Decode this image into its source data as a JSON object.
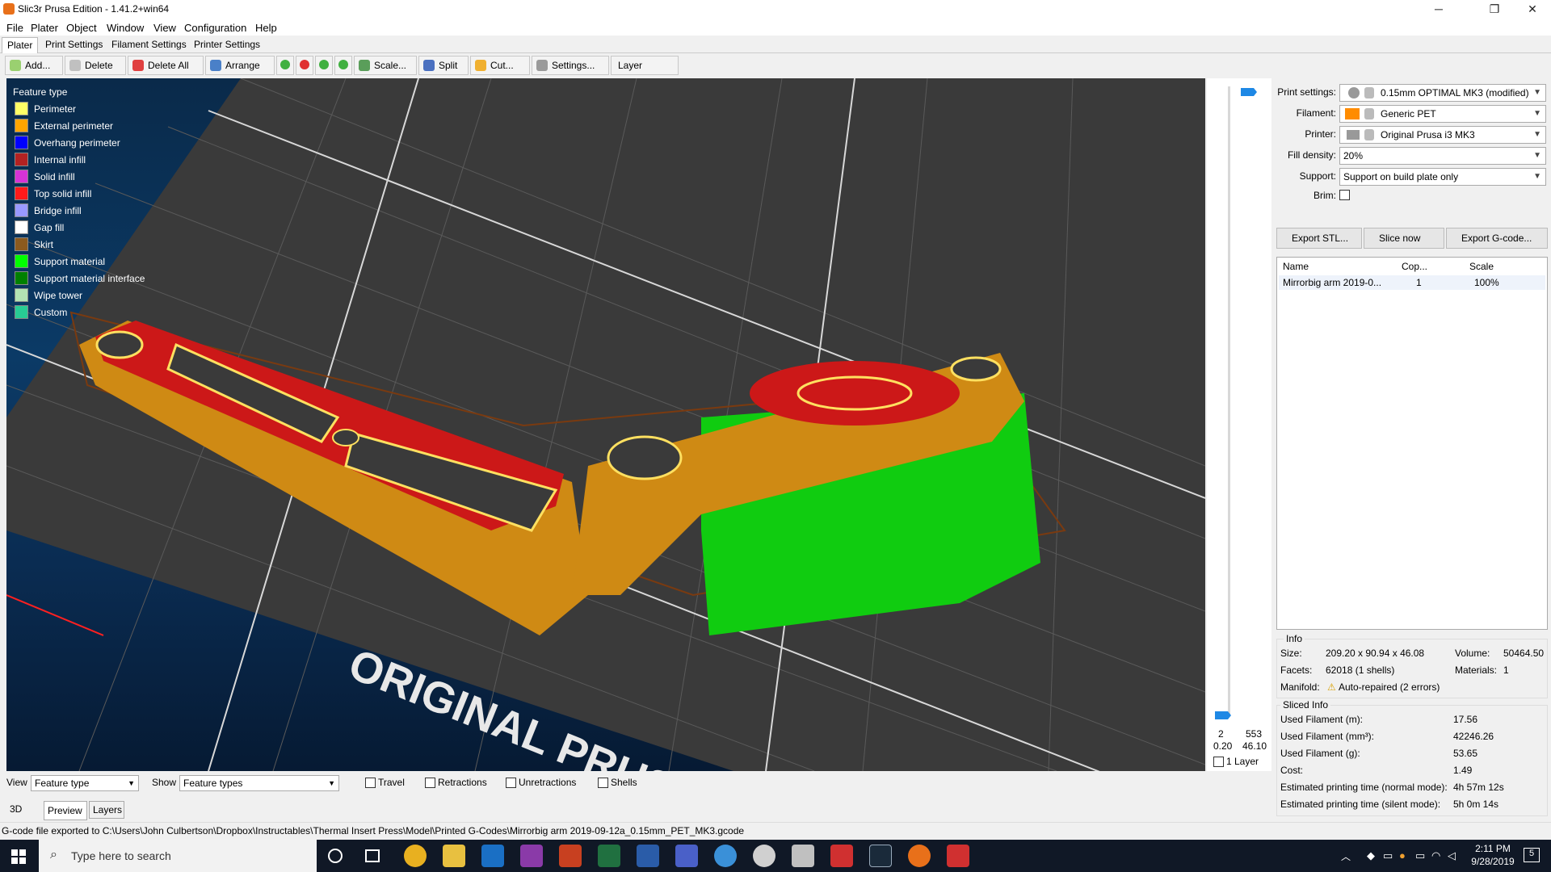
{
  "window": {
    "title": "Slic3r Prusa Edition - 1.41.2+win64",
    "minimize": "─",
    "maximize": "❐",
    "close": "✕"
  },
  "menu": [
    "File",
    "Plater",
    "Object",
    "Window",
    "View",
    "Configuration",
    "Help"
  ],
  "tabs": [
    "Plater",
    "Print Settings",
    "Filament Settings",
    "Printer Settings"
  ],
  "toolbar": {
    "add": "Add...",
    "delete": "Delete",
    "delete_all": "Delete All",
    "arrange": "Arrange",
    "scale": "Scale...",
    "split": "Split",
    "cut": "Cut...",
    "settings": "Settings...",
    "layer_editing": "Layer editing"
  },
  "legend": {
    "title": "Feature type",
    "items": [
      {
        "label": "Perimeter",
        "color": "#ffff66"
      },
      {
        "label": "External perimeter",
        "color": "#ffa500"
      },
      {
        "label": "Overhang perimeter",
        "color": "#0000ff"
      },
      {
        "label": "Internal infill",
        "color": "#b22222"
      },
      {
        "label": "Solid infill",
        "color": "#d633d6"
      },
      {
        "label": "Top solid infill",
        "color": "#ff1a1a"
      },
      {
        "label": "Bridge infill",
        "color": "#9999ff"
      },
      {
        "label": "Gap fill",
        "color": "#ffffff"
      },
      {
        "label": "Skirt",
        "color": "#8b5a1e"
      },
      {
        "label": "Support material",
        "color": "#00ff00"
      },
      {
        "label": "Support material interface",
        "color": "#008000"
      },
      {
        "label": "Wipe tower",
        "color": "#b3e3b3"
      },
      {
        "label": "Custom",
        "color": "#28cc94"
      }
    ]
  },
  "bed_label": "ORIGINAL PRUS",
  "layer_slider": {
    "top_layer": "2",
    "top_count": "553",
    "bottom_height": "0.20",
    "top_height": "46.10",
    "one_layer": "1 Layer"
  },
  "print_settings": {
    "print_label": "Print settings:",
    "print_value": "0.15mm OPTIMAL MK3 (modified)",
    "filament_label": "Filament:",
    "filament_value": "Generic PET",
    "filament_color": "#ff8c00",
    "printer_label": "Printer:",
    "printer_value": "Original Prusa i3 MK3",
    "fill_label": "Fill density:",
    "fill_value": "20%",
    "support_label": "Support:",
    "support_value": "Support on build plate only",
    "brim_label": "Brim:"
  },
  "actions": {
    "export_stl": "Export STL...",
    "slice_now": "Slice now",
    "export_gcode": "Export G-code..."
  },
  "object_list": {
    "headers": [
      "Name",
      "Cop...",
      "Scale"
    ],
    "rows": [
      {
        "name": "Mirrorbig arm 2019-0...",
        "copies": "1",
        "scale": "100%"
      }
    ]
  },
  "info": {
    "title": "Info",
    "size_label": "Size:",
    "size_value": "209.20 x 90.94 x 46.08",
    "volume_label": "Volume:",
    "volume_value": "50464.50",
    "facets_label": "Facets:",
    "facets_value": "62018 (1 shells)",
    "materials_label": "Materials:",
    "materials_value": "1",
    "manifold_label": "Manifold:",
    "manifold_value": "Auto-repaired (2 errors)"
  },
  "sliced": {
    "title": "Sliced Info",
    "rows": [
      {
        "label": "Used Filament (m):",
        "value": "17.56"
      },
      {
        "label": "Used Filament (mm³):",
        "value": "42246.26"
      },
      {
        "label": "Used Filament (g):",
        "value": "53.65"
      },
      {
        "label": "Cost:",
        "value": "1.49"
      },
      {
        "label": "Estimated printing time (normal mode):",
        "value": "4h 57m 12s"
      },
      {
        "label": "Estimated printing time (silent mode):",
        "value": "5h 0m 14s"
      }
    ]
  },
  "bottom": {
    "view_label": "View",
    "view_value": "Feature type",
    "show_label": "Show",
    "show_value": "Feature types",
    "travel": "Travel",
    "retractions": "Retractions",
    "unretractions": "Unretractions",
    "shells": "Shells",
    "tab_3d": "3D",
    "tab_preview": "Preview",
    "tab_layers": "Layers"
  },
  "status": "G-code file exported to C:\\Users\\John Culbertson\\Dropbox\\Instructables\\Thermal Insert Press\\Model\\Printed G-Codes\\Mirrorbig arm 2019-09-12a_0.15mm_PET_MK3.gcode",
  "taskbar": {
    "search_placeholder": "Type here to search",
    "time": "2:11 PM",
    "date": "9/28/2019",
    "notifications": "5"
  }
}
